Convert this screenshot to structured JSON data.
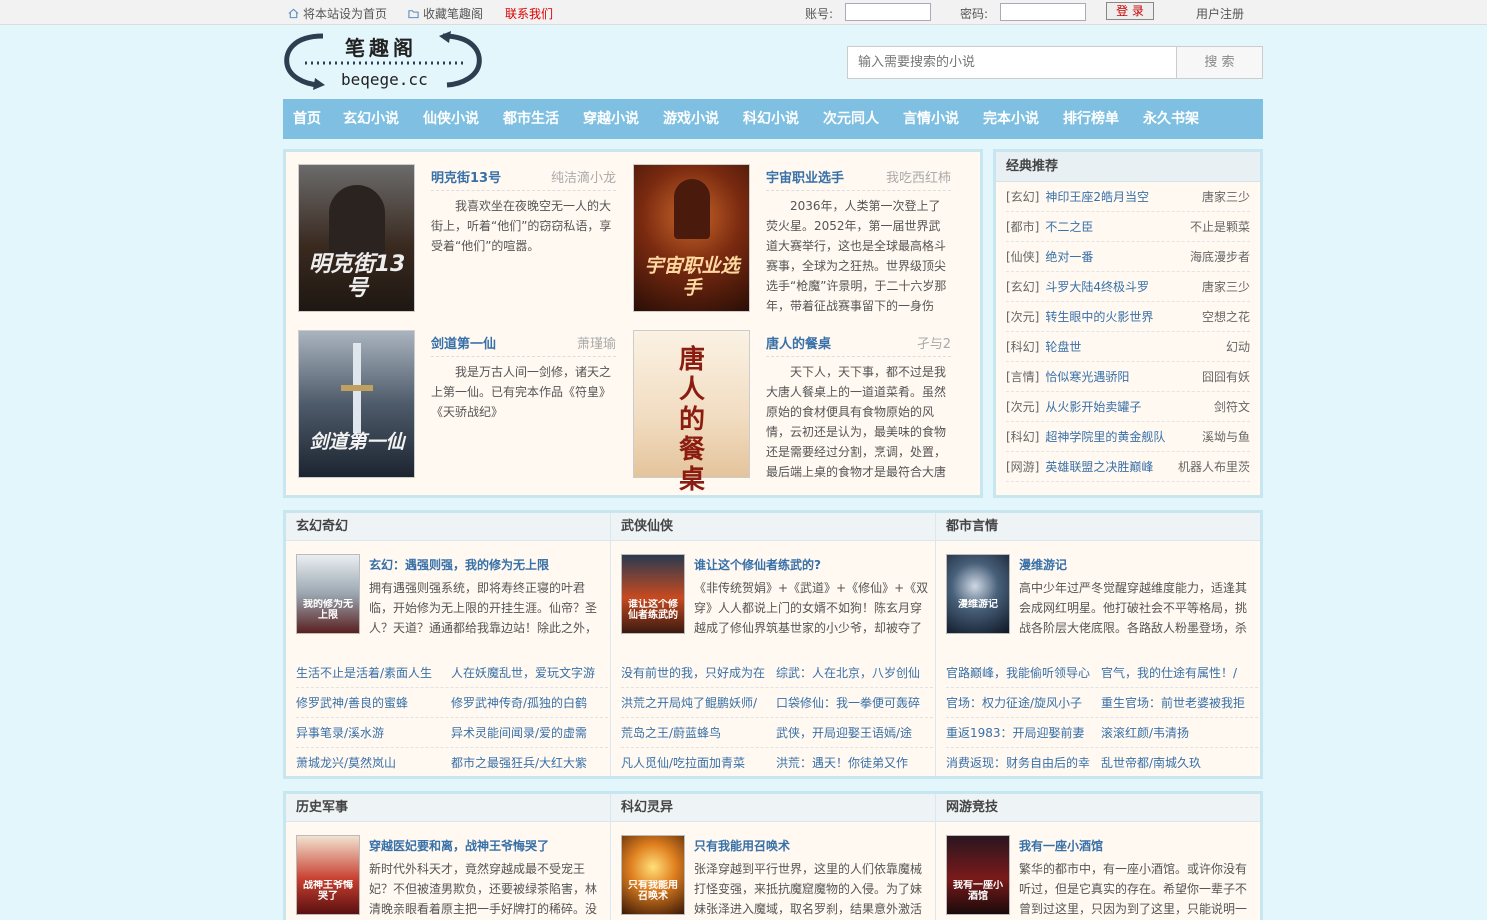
{
  "topbar": {
    "set_home": "将本站设为首页",
    "bookmark": "收藏笔趣阁",
    "contact": "联系我们",
    "account_label": "账号:",
    "password_label": "密码:",
    "login": "登 录",
    "register": "用户注册"
  },
  "logo": {
    "name": "笔趣阁",
    "domain": "beqege.cc"
  },
  "search": {
    "placeholder": "输入需要搜索的小说",
    "button": "搜 索"
  },
  "nav": [
    "首页",
    "玄幻小说",
    "仙侠小说",
    "都市生活",
    "穿越小说",
    "游戏小说",
    "科幻小说",
    "次元同人",
    "言情小说",
    "完本小说",
    "排行榜单",
    "永久书架"
  ],
  "featured": [
    {
      "title": "明克街13号",
      "author": "纯洁滴小龙",
      "desc": "我喜欢坐在夜晚空无一人的大街上，听着“他们”的窃窃私语，享受着“他们”的喧嚣。",
      "cover_text": "明克街13号"
    },
    {
      "title": "宇宙职业选手",
      "author": "我吃西红柿",
      "desc": "2036年，人类第一次登上了荧火星。2052年，第一届世界武道大赛举行，这也是全球最高格斗赛事，全球为之狂热。世界级顶尖选手“枪魔”许景明，于二十六岁那年，带着征战赛事留下的一身伤",
      "cover_text": "宇宙职业选手"
    },
    {
      "title": "剑道第一仙",
      "author": "萧瑾瑜",
      "desc": "我是万古人间一剑修，诸天之上第一仙。已有完本作品《符皇》《天骄战纪》",
      "cover_text": "剑道第一仙"
    },
    {
      "title": "唐人的餐桌",
      "author": "孑与2",
      "desc": "天下人，天下事，都不过是我大唐人餐桌上的一道道菜肴。虽然原始的食材便具有食物原始的风情，云初还是认为，最美味的食物还是需要经过分割，烹调，处置，最后端上桌的食物才是最符合大唐",
      "cover_text": "唐人的餐桌"
    }
  ],
  "classic": {
    "title": "经典推荐",
    "items": [
      {
        "cat": "[玄幻]",
        "title": "神印王座2皓月当空",
        "author": "唐家三少"
      },
      {
        "cat": "[都市]",
        "title": "不二之臣",
        "author": "不止是颗菜"
      },
      {
        "cat": "[仙侠]",
        "title": "绝对一番",
        "author": "海底漫步者"
      },
      {
        "cat": "[玄幻]",
        "title": "斗罗大陆4终极斗罗",
        "author": "唐家三少"
      },
      {
        "cat": "[次元]",
        "title": "转生眼中的火影世界",
        "author": "空想之花"
      },
      {
        "cat": "[科幻]",
        "title": "轮盘世",
        "author": "幻动"
      },
      {
        "cat": "[言情]",
        "title": "恰似寒光遇骄阳",
        "author": "囧囧有妖"
      },
      {
        "cat": "[次元]",
        "title": "从火影开始卖罐子",
        "author": "剑符文"
      },
      {
        "cat": "[科幻]",
        "title": "超神学院里的黄金舰队",
        "author": "溪坳与鱼"
      },
      {
        "cat": "[网游]",
        "title": "英雄联盟之决胜巅峰",
        "author": "机器人布里茨"
      }
    ]
  },
  "categories_row1": [
    {
      "name": "玄幻奇幻",
      "feat": {
        "title": "玄幻：遇强则强，我的修为无上限",
        "desc": "拥有遇强则强系统，即将寿终正寝的叶君临，开始修为无上限的开挂生涯。仙帝？圣人？天道？通通都给我靠边站！除此之外，他还收",
        "cover_text": "我的修为无上限"
      },
      "links": [
        [
          "生活不止是活着/素面人生",
          "人在妖魔乱世，爱玩文字游"
        ],
        [
          "修罗武神/善良的蜜蜂",
          "修罗武神传奇/孤独的白鹤"
        ],
        [
          "异事笔录/溪水游",
          "异术灵能间闻录/爱的虚需"
        ],
        [
          "萧城龙兴/莫然岚山",
          "都市之最强狂兵/大红大紫"
        ]
      ]
    },
    {
      "name": "武侠仙侠",
      "feat": {
        "title": "谁让这个修仙者练武的?",
        "desc": "《非传统贺娟》+《武道》+《修仙》+《双穿》人人都说上门的女婿不如狗！陈玄月穿越成了修仙界筑基世家的小少爷，却被夺了灵",
        "cover_text": "谁让这个修仙者练武的"
      },
      "links": [
        [
          "没有前世的我，只好成为在",
          "综武：人在北京，八岁创仙"
        ],
        [
          "洪荒之开局炖了鲲鹏妖师/",
          "口袋修仙：我一拳便可轰碎"
        ],
        [
          "荒岛之王/蔚蓝蜂鸟",
          "武侠，开局迎娶王语嫣/途"
        ],
        [
          "凡人觅仙/吃拉面加青菜",
          "洪荒：遇天！你徒弟又作"
        ]
      ]
    },
    {
      "name": "都市言情",
      "feat": {
        "title": "漫维游记",
        "desc": "高中少年过严冬觉醒穿越维度能力，适逢其会成网红明星。他打破社会不平等格局，挑战各阶层大佬底限。各路敌人粉墨登场，杀戮",
        "cover_text": "漫维游记"
      },
      "links": [
        [
          "官路巅峰，我能偷听领导心",
          "官气，我的仕途有属性！/"
        ],
        [
          "官场：权力征途/旋风小子",
          "重生官场：前世老婆被我拒"
        ],
        [
          "重返1983：开局迎娶前妻",
          "滚滚红颜/韦清扬"
        ],
        [
          "消费返现：财务自由后的幸",
          "乱世帝都/南城久玖"
        ]
      ]
    }
  ],
  "categories_row2": [
    {
      "name": "历史军事",
      "feat": {
        "title": "穿越医妃要和离，战神王爷悔哭了",
        "desc": "新时代外科天才，竟然穿越成最不受宠王妃？不但被渣男欺负，还要被绿茶陷害，林清晚亲眼看着原主把一手好牌打的稀碎。没关系，",
        "cover_text": "战神王爷悔哭了"
      }
    },
    {
      "name": "科幻灵异",
      "feat": {
        "title": "只有我能用召唤术",
        "desc": "张泽穿越到平行世界，这里的人们依靠魔械打怪变强，来抵抗魔窟魔物的入侵。为了妹妹张泽进入魔域，取名罗刹，结果意外激活召唤",
        "cover_text": "只有我能用召唤术"
      }
    },
    {
      "name": "网游竞技",
      "feat": {
        "title": "我有一座小酒馆",
        "desc": "繁华的都市中，有一座小酒馆。或许你没有听过，但是它真实的存在。希望你一辈子不曾到过这里，只因为到了这里，只能说明一件",
        "cover_text": "我有一座小酒馆"
      }
    }
  ],
  "colors": {
    "nav_bg": "#7fc0e2",
    "link": "#3870a8",
    "panel_border": "#c8e6f0",
    "page_bg": "#e3f6fb",
    "panel_bg": "#fff9f1"
  }
}
